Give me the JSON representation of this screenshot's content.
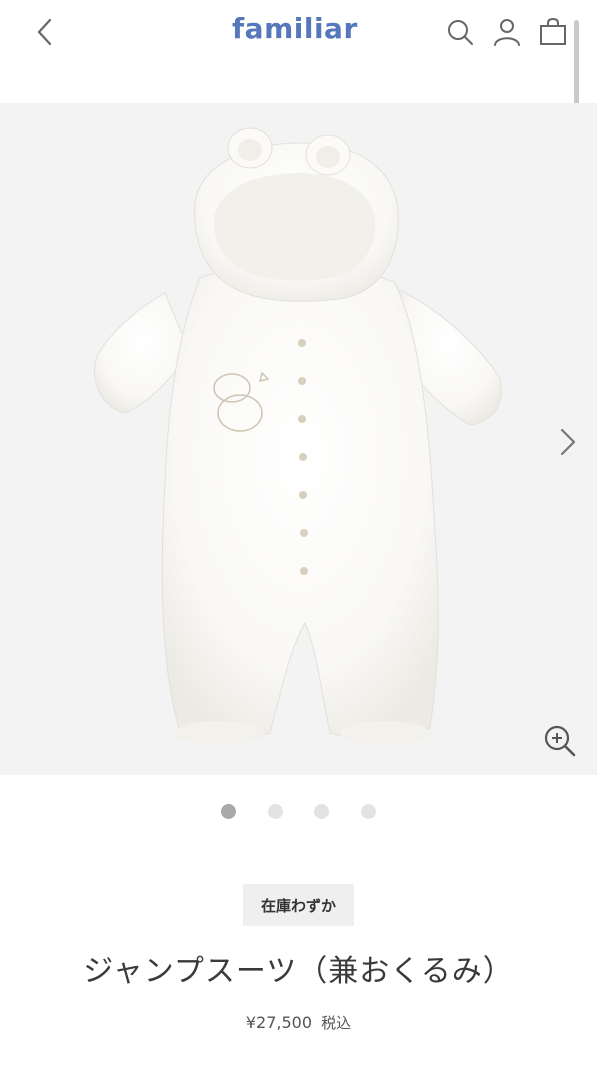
{
  "header": {
    "logo_text": "familiar",
    "brand_color": "#5577bb"
  },
  "gallery": {
    "image_alt": "ivory fleece jumpsuit with hood and ears",
    "slide_count": 4,
    "active_slide": 1
  },
  "product": {
    "stock_label": "在庫わずか",
    "title": "ジャンプスーツ（兼おくるみ）",
    "price": "¥27,500",
    "tax_label": "税込"
  },
  "icons": {
    "back": "chevron-left-icon",
    "search": "search-icon",
    "account": "user-icon",
    "cart": "bag-icon",
    "next": "chevron-right-icon",
    "zoom": "zoom-in-icon"
  }
}
